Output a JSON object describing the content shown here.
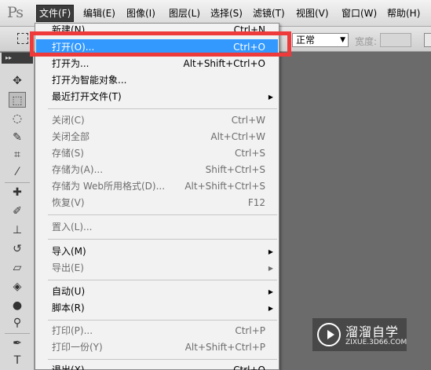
{
  "app": {
    "logo": "Ps"
  },
  "menubar": {
    "items": [
      {
        "label": "文件(F)"
      },
      {
        "label": "编辑(E)"
      },
      {
        "label": "图像(I)"
      },
      {
        "label": "图层(L)"
      },
      {
        "label": "选择(S)"
      },
      {
        "label": "滤镜(T)"
      },
      {
        "label": "视图(V)"
      },
      {
        "label": "窗口(W)"
      },
      {
        "label": "帮助(H)"
      }
    ]
  },
  "options": {
    "mode": "正常",
    "width_label": "宽度:"
  },
  "toolbox": {
    "grip": "▸▸",
    "tools": [
      "move-icon",
      "rect-marquee-icon",
      "lasso-icon",
      "quick-select-icon",
      "crop-icon",
      "eyedropper-icon",
      "healing-brush-icon",
      "brush-icon",
      "clone-stamp-icon",
      "history-brush-icon",
      "eraser-icon",
      "paint-bucket-icon",
      "blur-icon",
      "dodge-icon",
      "pen-icon",
      "type-icon"
    ]
  },
  "file_menu": {
    "items": [
      {
        "label": "新建(N)...",
        "shortcut": "Ctrl+N",
        "disabled": false
      },
      {
        "label": "打开(O)...",
        "shortcut": "Ctrl+O",
        "disabled": false,
        "highlighted": true
      },
      {
        "label": "打开为...",
        "shortcut": "Alt+Shift+Ctrl+O",
        "disabled": false
      },
      {
        "label": "打开为智能对象...",
        "shortcut": "",
        "disabled": false
      },
      {
        "label": "最近打开文件(T)",
        "shortcut": "",
        "submenu": true
      },
      {
        "label": "关闭(C)",
        "shortcut": "Ctrl+W",
        "disabled": true
      },
      {
        "label": "关闭全部",
        "shortcut": "Alt+Ctrl+W",
        "disabled": true
      },
      {
        "label": "存储(S)",
        "shortcut": "Ctrl+S",
        "disabled": true
      },
      {
        "label": "存储为(A)...",
        "shortcut": "Shift+Ctrl+S",
        "disabled": true
      },
      {
        "label": "存储为 Web所用格式(D)...",
        "shortcut": "Alt+Shift+Ctrl+S",
        "disabled": true
      },
      {
        "label": "恢复(V)",
        "shortcut": "F12",
        "disabled": true
      },
      {
        "label": "置入(L)...",
        "shortcut": "",
        "disabled": true
      },
      {
        "label": "导入(M)",
        "shortcut": "",
        "submenu": true
      },
      {
        "label": "导出(E)",
        "shortcut": "",
        "submenu": true,
        "disabled": true
      },
      {
        "label": "自动(U)",
        "shortcut": "",
        "submenu": true
      },
      {
        "label": "脚本(R)",
        "shortcut": "",
        "submenu": true
      },
      {
        "label": "打印(P)...",
        "shortcut": "Ctrl+P",
        "disabled": true
      },
      {
        "label": "打印一份(Y)",
        "shortcut": "Alt+Shift+Ctrl+P",
        "disabled": true
      },
      {
        "label": "退出(X)",
        "shortcut": "Ctrl+Q",
        "disabled": false
      }
    ]
  },
  "watermark": {
    "title": "溜溜自学",
    "url": "ZIXUE.3D66.COM"
  }
}
